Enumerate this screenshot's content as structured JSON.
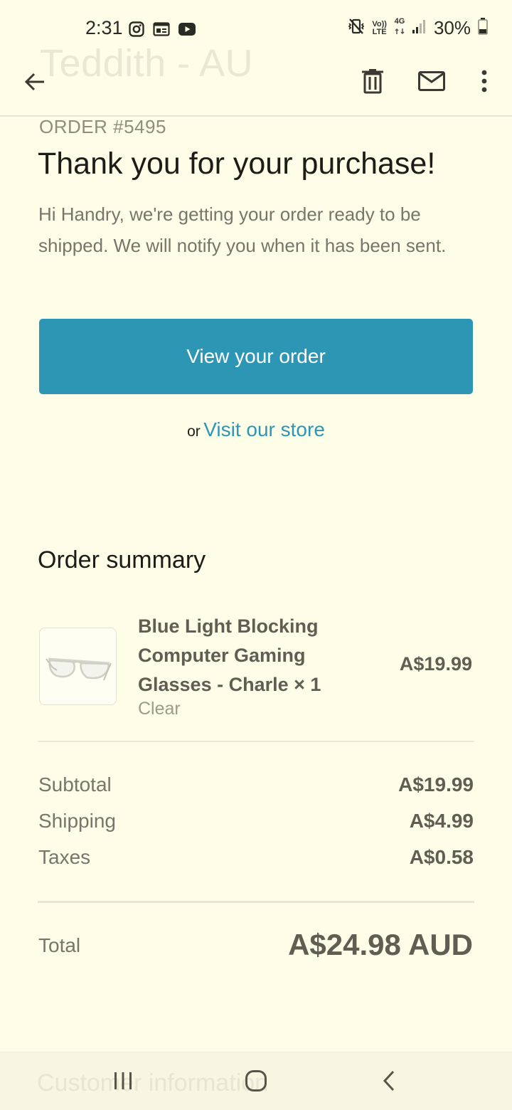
{
  "status_bar": {
    "time": "2:31",
    "battery": "30%",
    "left_icons": [
      "instagram-icon",
      "news-icon",
      "youtube-icon"
    ],
    "right_icons": [
      "mute-vibrate-icon",
      "volte-icon",
      "4g-data-icon",
      "signal-icon",
      "battery-icon"
    ],
    "volte_label_top": "Vo))",
    "volte_label_bottom": "LTE",
    "data_label": "4G"
  },
  "header": {
    "ghost_title": "Teddith - AU",
    "actions": [
      "back-icon",
      "delete-icon",
      "mark-unread-icon",
      "more-options-icon"
    ]
  },
  "email": {
    "order_number": "ORDER #5495",
    "headline": "Thank you for your purchase!",
    "intro": "Hi Handry, we're getting your order ready to be shipped. We will notify you when it has been sent.",
    "view_order_label": "View your order",
    "or_text": "or",
    "visit_store_label": "Visit our store",
    "accent_color": "#2e96b5"
  },
  "summary": {
    "title": "Order summary",
    "item": {
      "name": "Blue Light Blocking Computer Gaming Glasses - Charle × 1",
      "variant": "Clear",
      "price": "A$19.99",
      "thumbnail_icon": "glasses-icon"
    },
    "costs": [
      {
        "label": "Subtotal",
        "value": "A$19.99"
      },
      {
        "label": "Shipping",
        "value": "A$4.99"
      },
      {
        "label": "Taxes",
        "value": "A$0.58"
      }
    ],
    "total_label": "Total",
    "total_value": "A$24.98 AUD"
  },
  "nav_bar": {
    "ghost_text": "Customer information",
    "buttons": [
      "recents-icon",
      "home-icon",
      "nav-back-icon"
    ]
  }
}
